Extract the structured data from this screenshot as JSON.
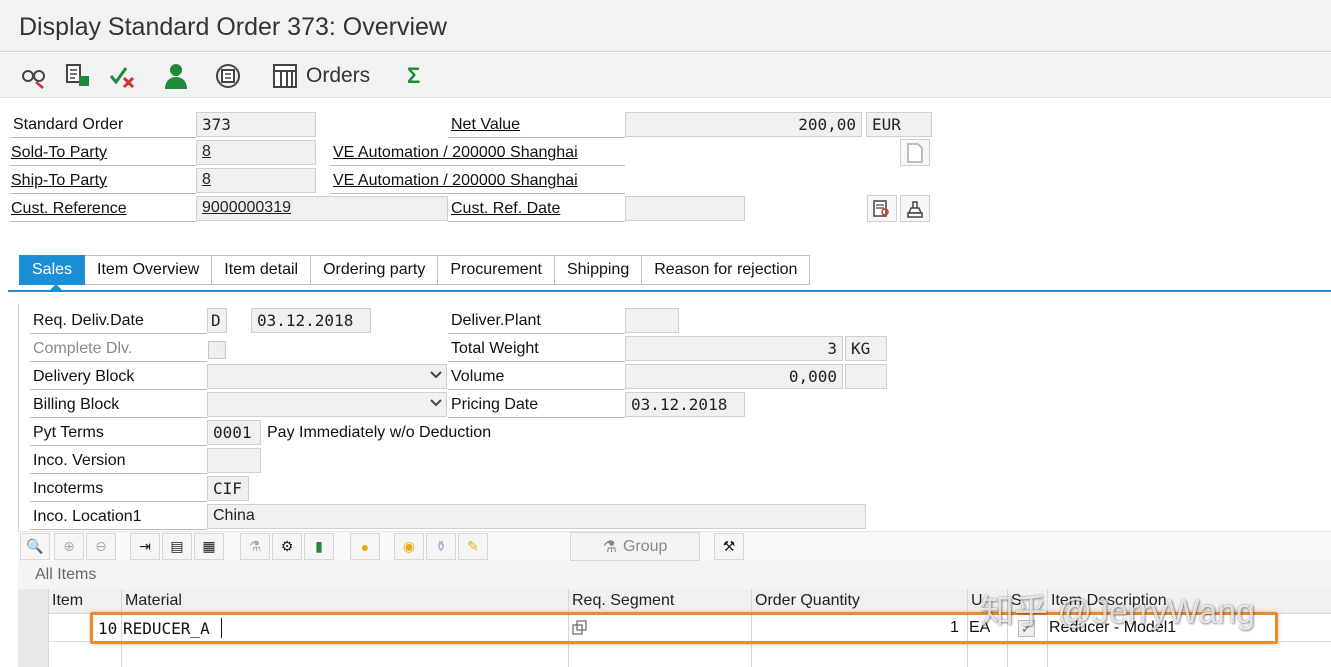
{
  "window": {
    "title": "Display Standard Order 373: Overview"
  },
  "toolbar": {
    "orders_label": "Orders",
    "sigma_label": "Σ"
  },
  "header": {
    "standard_order_label": "Standard Order",
    "standard_order_value": "373",
    "net_value_label": "Net Value",
    "net_value": "200,00",
    "currency": "EUR",
    "sold_to_label": "Sold-To Party",
    "sold_to_value": "8",
    "sold_to_name": "VE Automation / 200000 Shanghai",
    "ship_to_label": "Ship-To Party",
    "ship_to_value": "8",
    "ship_to_name": "VE Automation / 200000 Shanghai",
    "cust_ref_label": "Cust. Reference",
    "cust_ref_value": "9000000319",
    "cust_ref_date_label": "Cust. Ref. Date",
    "cust_ref_date_value": ""
  },
  "tabs": [
    {
      "label": "Sales",
      "active": true
    },
    {
      "label": "Item Overview"
    },
    {
      "label": "Item detail"
    },
    {
      "label": "Ordering party"
    },
    {
      "label": "Procurement"
    },
    {
      "label": "Shipping"
    },
    {
      "label": "Reason for rejection"
    }
  ],
  "sales": {
    "req_deliv_date_label": "Req. Deliv.Date",
    "req_deliv_date_type": "D",
    "req_deliv_date": "03.12.2018",
    "complete_dlv_label": "Complete Dlv.",
    "delivery_block_label": "Delivery Block",
    "billing_block_label": "Billing Block",
    "pyt_terms_label": "Pyt Terms",
    "pyt_terms_code": "0001",
    "pyt_terms_text": "Pay Immediately w/o Deduction",
    "inco_version_label": "Inco. Version",
    "incoterms_label": "Incoterms",
    "incoterms_value": "CIF",
    "inco_location_label": "Inco. Location1",
    "inco_location_value": "China",
    "deliver_plant_label": "Deliver.Plant",
    "total_weight_label": "Total Weight",
    "total_weight_value": "3",
    "total_weight_unit": "KG",
    "volume_label": "Volume",
    "volume_value": "0,000",
    "pricing_date_label": "Pricing Date",
    "pricing_date_value": "03.12.2018"
  },
  "items_toolbar": {
    "group_label": "Group"
  },
  "items": {
    "section_label": "All Items",
    "columns": [
      "Item",
      "Material",
      "Req. Segment",
      "Order Quantity",
      "U",
      "S",
      "Item Description"
    ],
    "rows": [
      {
        "item": "10",
        "material": "REDUCER_A",
        "req_segment": "",
        "order_quantity": "1",
        "unit": "EA",
        "description": "Reducer - Model1"
      }
    ]
  },
  "watermark": "知乎 @JerryWang",
  "colors": {
    "accent": "#1b8fd6",
    "highlight": "#e88a2e",
    "green": "#1f8a3a",
    "red": "#d0312d"
  }
}
